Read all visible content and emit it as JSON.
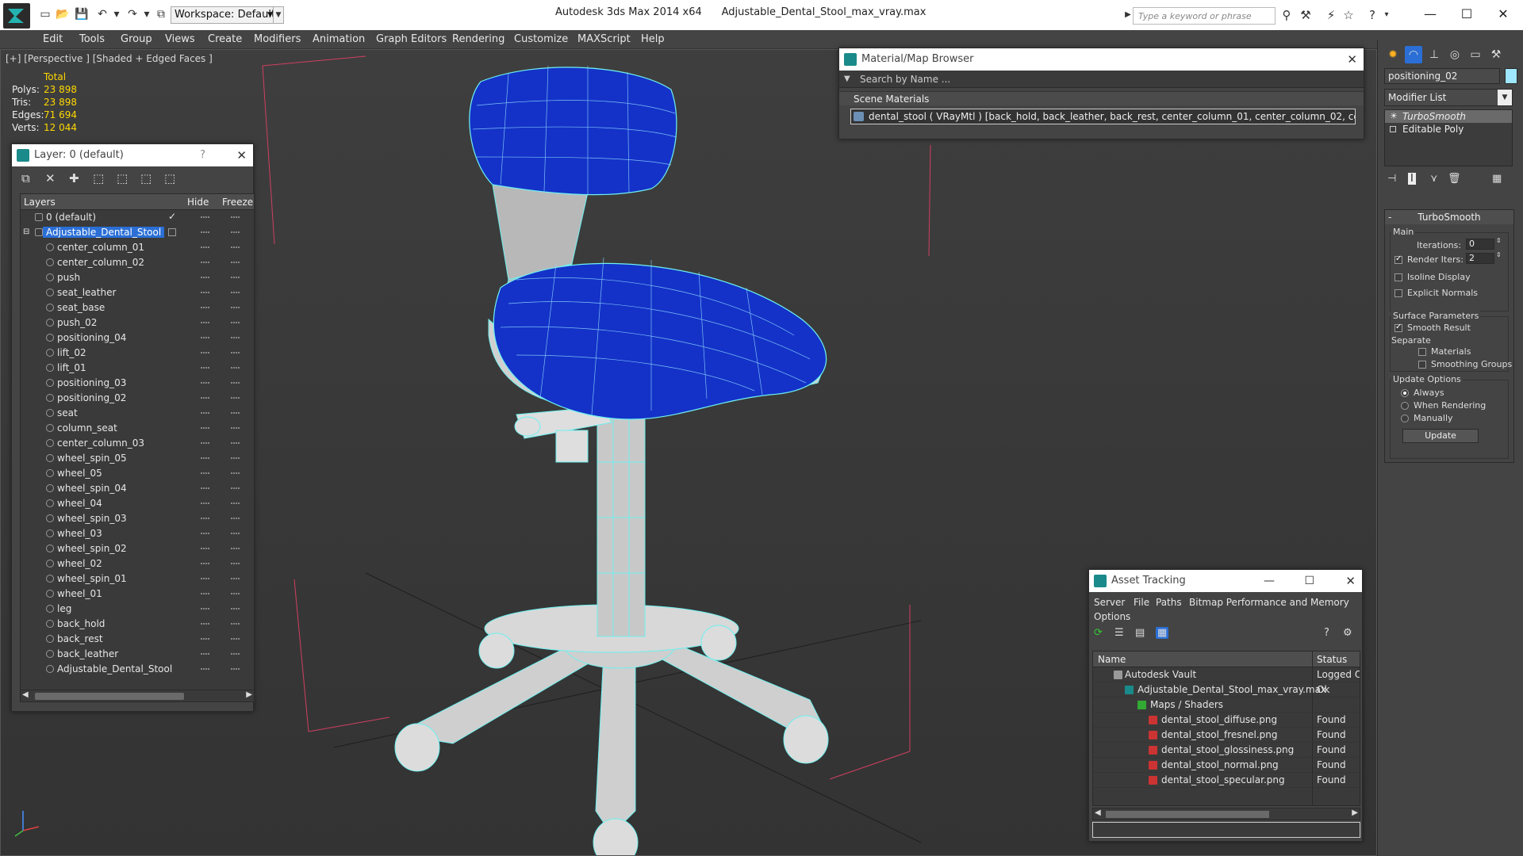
{
  "titlebar": {
    "workspace": "Workspace: Default",
    "app_title": "Autodesk 3ds Max  2014 x64",
    "file_name": "Adjustable_Dental_Stool_max_vray.max",
    "search_placeholder": "Type a keyword or phrase"
  },
  "menu": [
    "Edit",
    "Tools",
    "Group",
    "Views",
    "Create",
    "Modifiers",
    "Animation",
    "Graph Editors",
    "Rendering",
    "Customize",
    "MAXScript",
    "Help"
  ],
  "viewport": {
    "label": "[+] [Perspective ] [Shaded + Edged Faces ]",
    "stats": {
      "header": "Total",
      "rows": [
        {
          "k": "Polys:",
          "v": "23 898"
        },
        {
          "k": "Tris:",
          "v": "23 898"
        },
        {
          "k": "Edges:",
          "v": "71 694"
        },
        {
          "k": "Verts:",
          "v": "12 044"
        }
      ]
    },
    "colors": {
      "seat_blue": "#1432c8",
      "wire": "#6ff0f0",
      "frame": "#c8c8c8"
    }
  },
  "layers": {
    "title": "Layer: 0 (default)",
    "help": "?",
    "col_layers": "Layers",
    "col_hide": "Hide",
    "col_freeze": "Freeze",
    "default_layer": "0 (default)",
    "selected_layer": "Adjustable_Dental_Stool",
    "objects": [
      "center_column_01",
      "center_column_02",
      "push",
      "seat_leather",
      "seat_base",
      "push_02",
      "positioning_04",
      "lift_02",
      "lift_01",
      "positioning_03",
      "positioning_02",
      "seat",
      "column_seat",
      "center_column_03",
      "wheel_spin_05",
      "wheel_05",
      "wheel_spin_04",
      "wheel_04",
      "wheel_spin_03",
      "wheel_03",
      "wheel_spin_02",
      "wheel_02",
      "wheel_spin_01",
      "wheel_01",
      "leg",
      "back_hold",
      "back_rest",
      "back_leather",
      "Adjustable_Dental_Stool"
    ]
  },
  "material_browser": {
    "title": "Material/Map Browser",
    "search_placeholder": "Search by Name ...",
    "section": "Scene Materials",
    "row": "dental_stool  ( VRayMtl )  [back_hold, back_leather, back_rest, center_column_01, center_column_02, center_column..."
  },
  "command_panel": {
    "object_name": "positioning_02",
    "modifier_list": "Modifier List",
    "stack": [
      "TurboSmooth",
      "Editable Poly"
    ],
    "rollout_title": "TurboSmooth",
    "main_label": "Main",
    "iterations_label": "Iterations:",
    "iterations_value": "0",
    "render_iters_label": "Render Iters:",
    "render_iters_value": "2",
    "isoline": "Isoline Display",
    "explicit": "Explicit Normals",
    "surface_label": "Surface Parameters",
    "smooth_result": "Smooth Result",
    "separate_label": "Separate",
    "materials": "Materials",
    "smoothing_groups": "Smoothing Groups",
    "update_label": "Update Options",
    "always": "Always",
    "when_rendering": "When Rendering",
    "manually": "Manually",
    "update_btn": "Update"
  },
  "asset_tracking": {
    "title": "Asset Tracking",
    "menu": [
      "Server",
      "File",
      "Paths",
      "Bitmap Performance and Memory",
      "Options"
    ],
    "col_name": "Name",
    "col_status": "Status",
    "rows": [
      {
        "name": "Autodesk Vault",
        "status": "Logged Ou"
      },
      {
        "name": "Adjustable_Dental_Stool_max_vray.max",
        "status": "Ok"
      },
      {
        "name": "Maps / Shaders",
        "status": ""
      },
      {
        "name": "dental_stool_diffuse.png",
        "status": "Found"
      },
      {
        "name": "dental_stool_fresnel.png",
        "status": "Found"
      },
      {
        "name": "dental_stool_glossiness.png",
        "status": "Found"
      },
      {
        "name": "dental_stool_normal.png",
        "status": "Found"
      },
      {
        "name": "dental_stool_specular.png",
        "status": "Found"
      }
    ]
  }
}
